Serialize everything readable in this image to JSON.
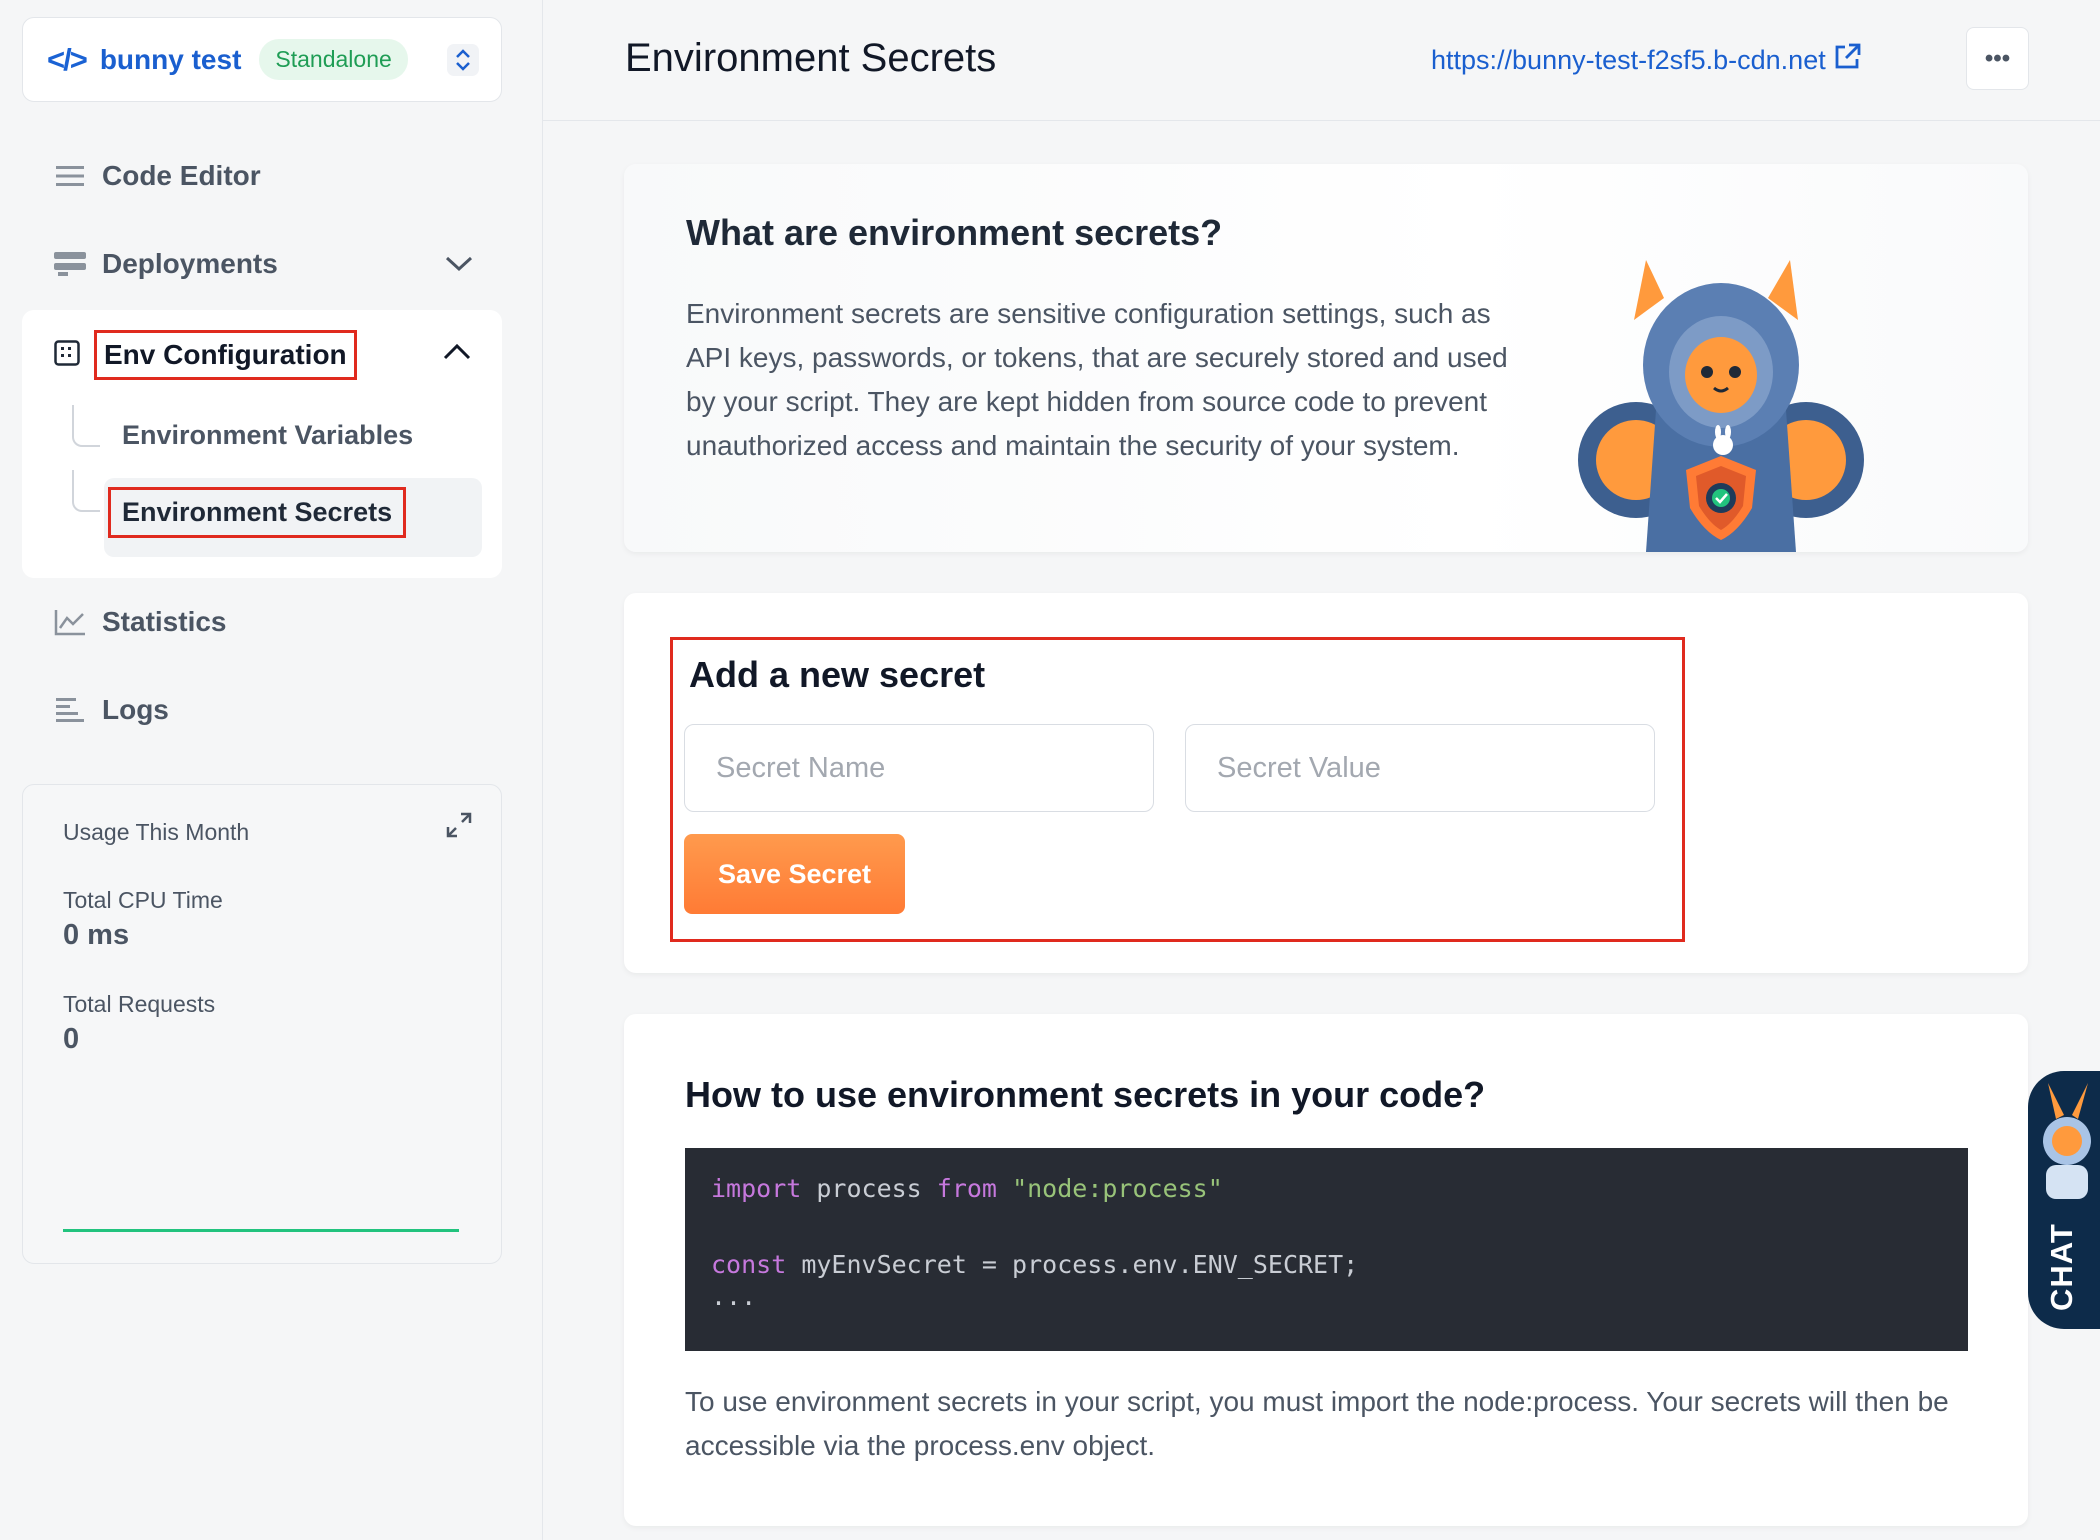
{
  "project": {
    "name": "bunny test",
    "badge": "Standalone"
  },
  "nav": {
    "code_editor": "Code Editor",
    "deployments": "Deployments",
    "env_configuration": "Env Configuration",
    "env_variables": "Environment Variables",
    "env_secrets": "Environment Secrets",
    "statistics": "Statistics",
    "logs": "Logs"
  },
  "usage": {
    "title": "Usage This Month",
    "cpu_label": "Total CPU Time",
    "cpu_value": "0 ms",
    "requests_label": "Total Requests",
    "requests_value": "0"
  },
  "header": {
    "title": "Environment Secrets",
    "url": "https://bunny-test-f2sf5.b-cdn.net",
    "more": "•••"
  },
  "info": {
    "title": "What are environment secrets?",
    "text": "Environment secrets are sensitive configuration settings, such as API keys, passwords, or tokens, that are securely stored and used by your script. They are kept hidden from source code to prevent unauthorized access and maintain the security of your system."
  },
  "add": {
    "title": "Add a new secret",
    "name_placeholder": "Secret Name",
    "value_placeholder": "Secret Value",
    "save": "Save Secret"
  },
  "howto": {
    "title": "How to use environment secrets in your code?",
    "code": {
      "l1_kw1": "import",
      "l1_mid": " process ",
      "l1_kw2": "from",
      "l1_str": "\"node:process\"",
      "l3_kw": "const",
      "l3_rest": " myEnvSecret = process.env.ENV_SECRET;",
      "l4": "..."
    },
    "text": "To use environment secrets in your script, you must import the node:process. Your secrets will then be accessible via the process.env object."
  },
  "chat": {
    "label": "CHAT"
  },
  "colors": {
    "brand": "#1a5fcf",
    "accent": "#ff8a3d",
    "highlight": "#e02a1e",
    "success": "#22c37e"
  }
}
